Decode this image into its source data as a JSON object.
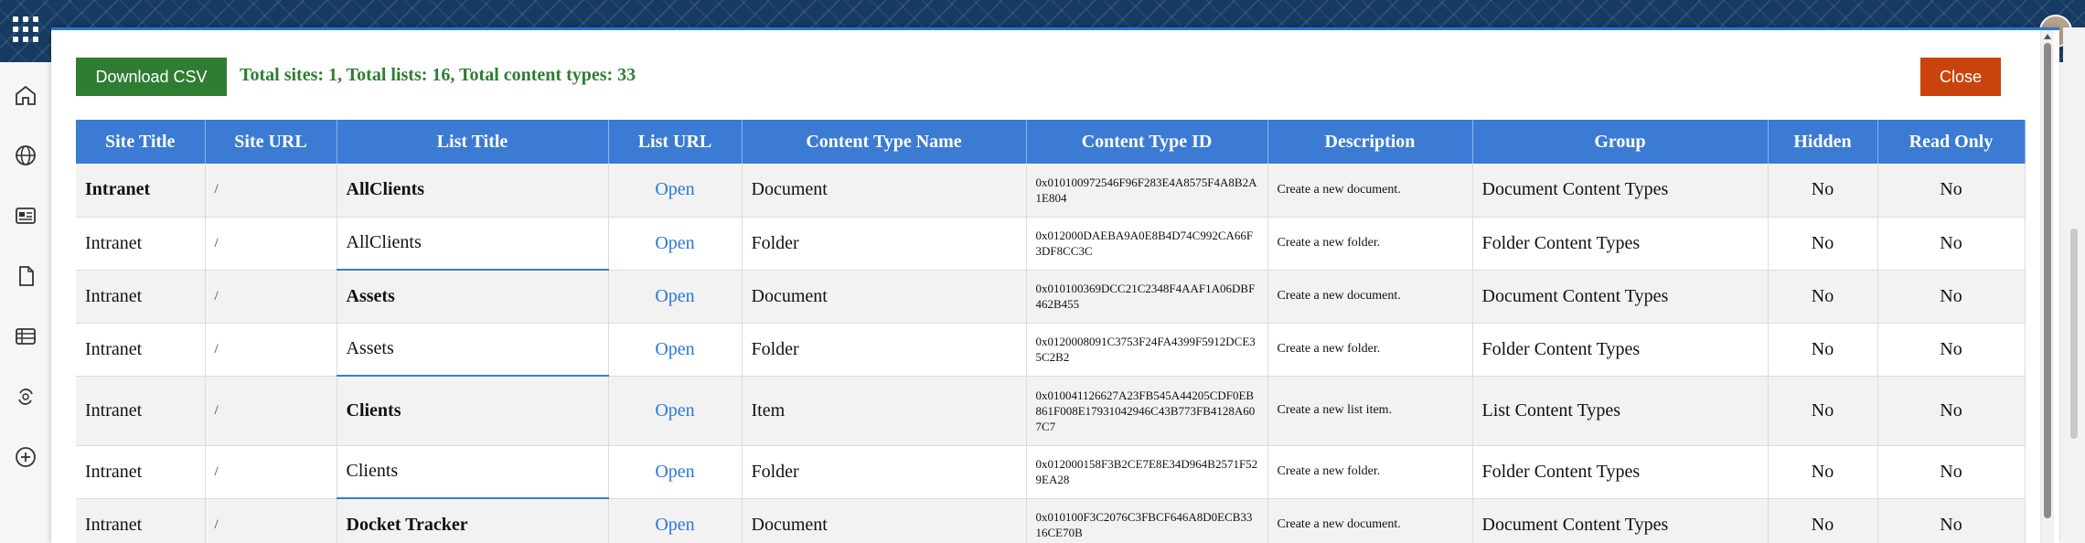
{
  "modal": {
    "download_label": "Download CSV",
    "summary": "Total sites: 1, Total lists: 16, Total content types: 33",
    "close_label": "Close"
  },
  "columns": [
    "Site Title",
    "Site URL",
    "List Title",
    "List URL",
    "Content Type Name",
    "Content Type ID",
    "Description",
    "Group",
    "Hidden",
    "Read Only"
  ],
  "rows": [
    {
      "site_title": "Intranet",
      "site_url": "/",
      "list_title": "AllClients",
      "list_url": "Open",
      "ct_name": "Document",
      "ct_id": "0x010100972546F96F283E4A8575F4A8B2A1E804",
      "description": "Create a new document.",
      "group": "Document Content Types",
      "hidden": "No",
      "read_only": "No"
    },
    {
      "site_title": "Intranet",
      "site_url": "/",
      "list_title": "AllClients",
      "list_url": "Open",
      "ct_name": "Folder",
      "ct_id": "0x012000DAEBA9A0E8B4D74C992CA66F3DF8CC3C",
      "description": "Create a new folder.",
      "group": "Folder Content Types",
      "hidden": "No",
      "read_only": "No"
    },
    {
      "site_title": "Intranet",
      "site_url": "/",
      "list_title": "Assets",
      "list_url": "Open",
      "ct_name": "Document",
      "ct_id": "0x010100369DCC21C2348F4AAF1A06DBF462B455",
      "description": "Create a new document.",
      "group": "Document Content Types",
      "hidden": "No",
      "read_only": "No"
    },
    {
      "site_title": "Intranet",
      "site_url": "/",
      "list_title": "Assets",
      "list_url": "Open",
      "ct_name": "Folder",
      "ct_id": "0x0120008091C3753F24FA4399F5912DCE35C2B2",
      "description": "Create a new folder.",
      "group": "Folder Content Types",
      "hidden": "No",
      "read_only": "No"
    },
    {
      "site_title": "Intranet",
      "site_url": "/",
      "list_title": "Clients",
      "list_url": "Open",
      "ct_name": "Item",
      "ct_id": "0x010041126627A23FB545A44205CDF0EB861F008E17931042946C43B773FB4128A607C7",
      "description": "Create a new list item.",
      "group": "List Content Types",
      "hidden": "No",
      "read_only": "No"
    },
    {
      "site_title": "Intranet",
      "site_url": "/",
      "list_title": "Clients",
      "list_url": "Open",
      "ct_name": "Folder",
      "ct_id": "0x012000158F3B2CE7E8E34D964B2571F529EA28",
      "description": "Create a new folder.",
      "group": "Folder Content Types",
      "hidden": "No",
      "read_only": "No"
    },
    {
      "site_title": "Intranet",
      "site_url": "/",
      "list_title": "Docket Tracker",
      "list_url": "Open",
      "ct_name": "Document",
      "ct_id": "0x010100F3C2076C3FBCF646A8D0ECB3316CE70B",
      "description": "Create a new document.",
      "group": "Document Content Types",
      "hidden": "No",
      "read_only": "No"
    }
  ],
  "left_rail": {
    "icons": [
      "home-icon",
      "globe-icon",
      "news-icon",
      "document-icon",
      "list-icon",
      "sync-icon",
      "add-icon"
    ]
  },
  "colors": {
    "header_blue": "#3b7bd4",
    "download_green": "#2e7d32",
    "close_orange": "#c9440d",
    "link_blue": "#2b78d8"
  }
}
